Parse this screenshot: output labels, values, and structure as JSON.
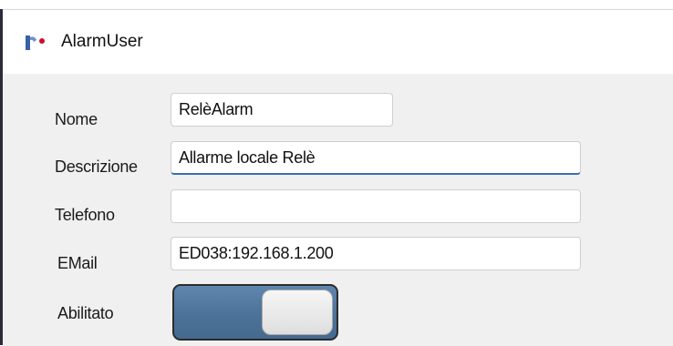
{
  "window": {
    "title": "AlarmUser",
    "icon": "app-logo-icon"
  },
  "form": {
    "nome": {
      "label": "Nome",
      "value": "RelèAlarm"
    },
    "descrizione": {
      "label": "Descrizione",
      "value": "Allarme locale Relè"
    },
    "telefono": {
      "label": "Telefono",
      "value": ""
    },
    "email": {
      "label": "EMail",
      "value": "ED038:192.168.1.200"
    },
    "abilitato": {
      "label": "Abilitato",
      "enabled": true
    }
  },
  "colors": {
    "toggle_on": "#4d7298",
    "focus_underline": "#3a6fb0",
    "window_background": "#f0f0f0"
  }
}
